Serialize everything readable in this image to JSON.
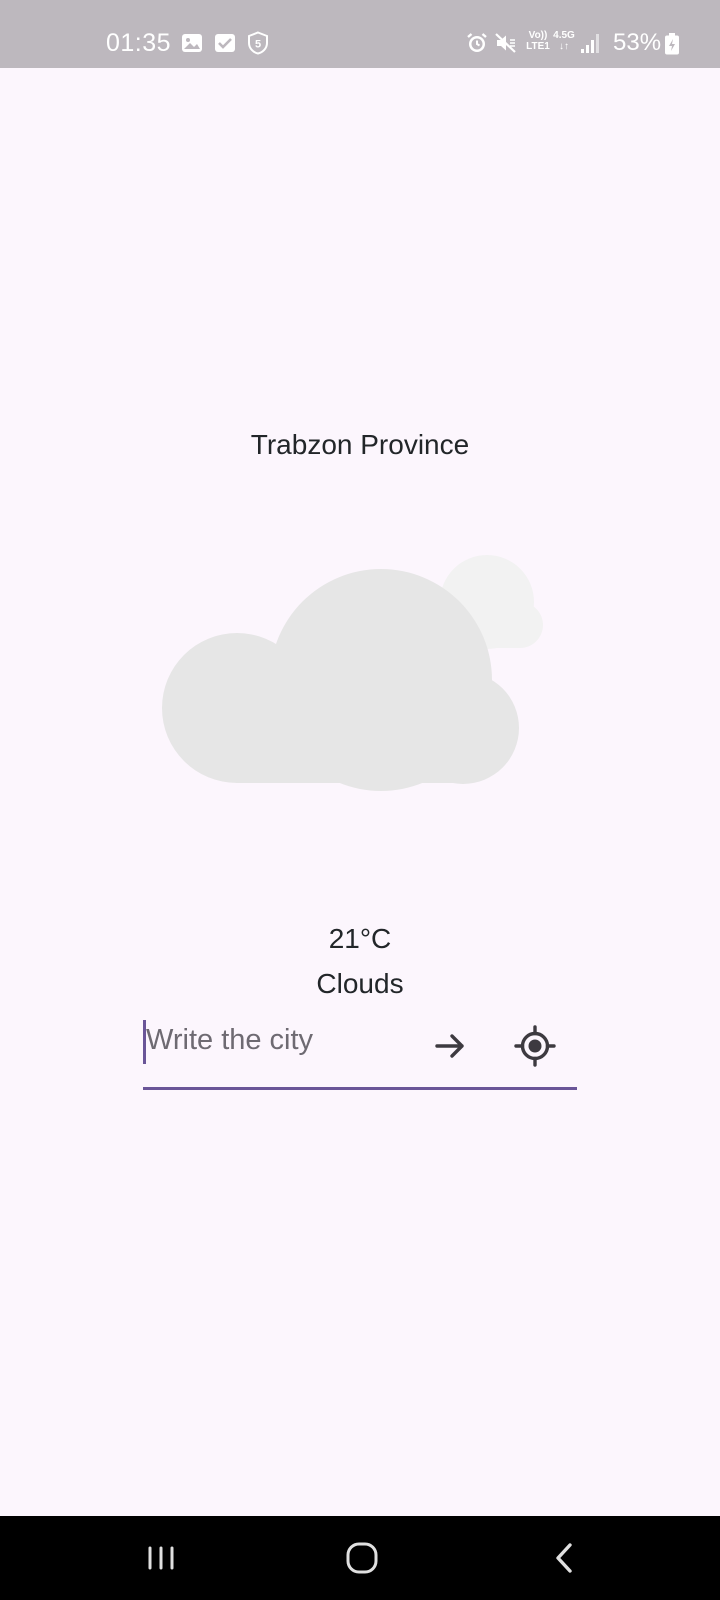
{
  "status_bar": {
    "time": "01:35",
    "left_icons": [
      "gallery-icon",
      "checkbox-icon",
      "shield-5-icon"
    ],
    "right_icons": [
      "alarm-icon",
      "mute-icon",
      "signal-icon",
      "battery-icon"
    ],
    "network_top": "Vo)) 4.5G",
    "network_voice": "Vo))",
    "network_lte": "LTE1",
    "network_type": "4.5G",
    "network_arrows": "↓↑",
    "battery_percent": "53%"
  },
  "weather": {
    "city": "Trabzon Province",
    "temperature": "21°C",
    "condition": "Clouds",
    "icon": "cloud-icon"
  },
  "search": {
    "placeholder": "Write the city",
    "value": "",
    "submit_icon": "arrow-right-icon",
    "location_icon": "gps-locate-icon"
  },
  "nav_bar": {
    "buttons": [
      "recents-icon",
      "home-icon",
      "back-icon"
    ]
  },
  "colors": {
    "background": "#fcf6fd",
    "status_bar": "#bdb8be",
    "accent": "#6a5598",
    "text": "#222629",
    "cloud_front": "#e6e6e6",
    "cloud_back": "#f2f2f2"
  }
}
